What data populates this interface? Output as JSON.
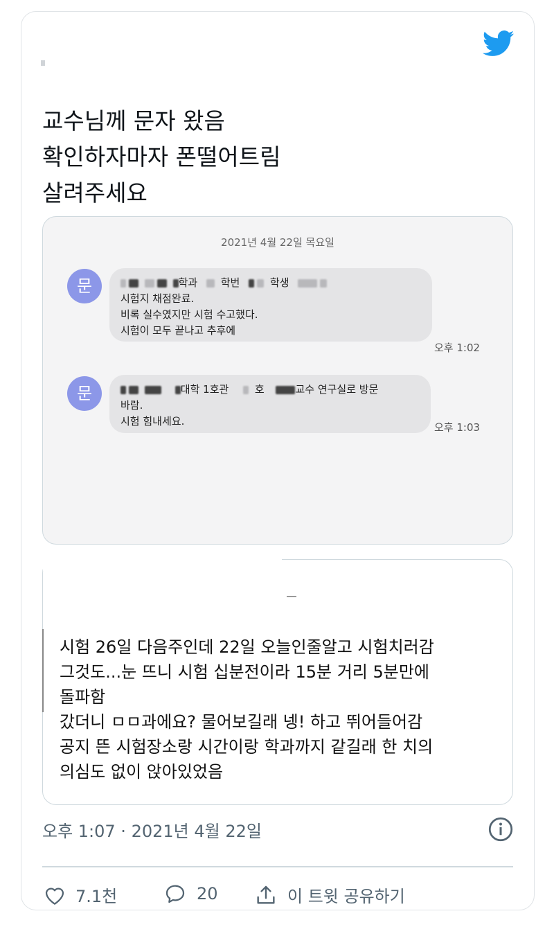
{
  "tweet": {
    "lines": [
      "교수님께 문자 왔음",
      "확인하자마자 폰떨어트림",
      "살려주세요"
    ]
  },
  "sms": {
    "date_header": "2021년 4월 22일 목요일",
    "sender_initial": "문",
    "messages": [
      {
        "header_fragments": [
          "학과",
          "학번",
          "학생"
        ],
        "lines": [
          "시험지 채점완료.",
          "비록 실수였지만 시험 수고했다.",
          "시험이 모두 끝나고 추후에"
        ],
        "time": "오후 1:02"
      },
      {
        "header_fragments": [
          "대학 1호관",
          "호",
          "교수 연구실로 방문"
        ],
        "lines": [
          "바람.",
          "시험 힘내세요."
        ],
        "time": "오후 1:03"
      }
    ]
  },
  "quote": {
    "lines": [
      "시험 26일 다음주인데 22일 오늘인줄알고 시험치러감",
      "그것도...눈 뜨니 시험 십분전이라 15분 거리 5분만에",
      "돌파함",
      "갔더니 ㅁㅁ과에요? 물어보길래 넹! 하고 뛰어들어감",
      "공지 뜬 시험장소랑 시간이랑 학과까지 같길래 한 치의",
      "의심도 없이 앉아있었음"
    ]
  },
  "meta": {
    "timestamp": "오후 1:07 · 2021년 4월 22일"
  },
  "actions": {
    "likes": "7.1천",
    "replies": "20",
    "share_label": "이 트윗 공유하기"
  },
  "colors": {
    "twitter_blue": "#1d9bf0",
    "avatar_purple": "#8c97e8",
    "meta_gray": "#536471"
  }
}
